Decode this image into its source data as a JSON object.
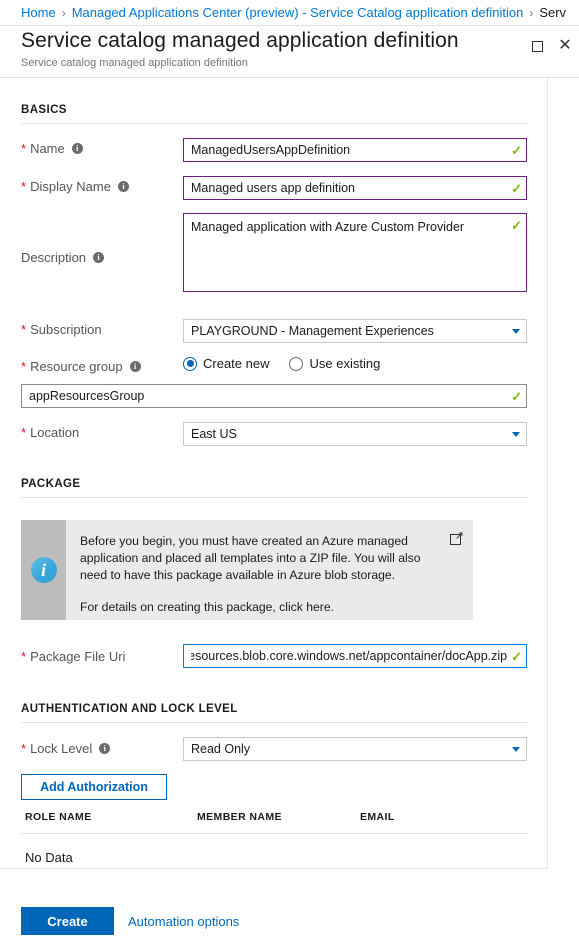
{
  "breadcrumb": {
    "items": [
      {
        "label": "Home"
      },
      {
        "label": "Managed Applications Center (preview) - Service Catalog application definition"
      },
      {
        "label": "Serv"
      }
    ],
    "separator": "›"
  },
  "blade": {
    "title": "Service catalog managed application definition",
    "subtitle": "Service catalog managed application definition",
    "maximize_icon": "maximize-icon",
    "close_icon": "close-icon"
  },
  "sections": {
    "basics": "BASICS",
    "package": "PACKAGE",
    "auth": "AUTHENTICATION AND LOCK LEVEL"
  },
  "fields": {
    "name": {
      "label": "Name",
      "required_marker": "*",
      "info": "i",
      "value": "ManagedUsersAppDefinition",
      "valid_icon": "✓"
    },
    "display_name": {
      "label": "Display Name",
      "required_marker": "*",
      "info": "i",
      "value": "Managed users app definition",
      "valid_icon": "✓"
    },
    "description": {
      "label": "Description",
      "info": "i",
      "value": "Managed application with Azure Custom Provider",
      "valid_icon": "✓"
    },
    "subscription": {
      "label": "Subscription",
      "required_marker": "*",
      "value": "PLAYGROUND - Management Experiences"
    },
    "resource_group": {
      "label": "Resource group",
      "required_marker": "*",
      "info": "i",
      "options": [
        {
          "label": "Create new",
          "selected": true
        },
        {
          "label": "Use existing",
          "selected": false
        }
      ],
      "value": "appResourcesGroup",
      "valid_icon": "✓"
    },
    "location": {
      "label": "Location",
      "required_marker": "*",
      "value": "East US"
    },
    "package_file_uri": {
      "label": "Package File Uri",
      "required_marker": "*",
      "value": "resources.blob.core.windows.net/appcontainer/docApp.zip",
      "valid_icon": "✓"
    },
    "lock_level": {
      "label": "Lock Level",
      "required_marker": "*",
      "info": "i",
      "value": "Read Only"
    }
  },
  "info_banner": {
    "icon": "info-icon",
    "paragraph1": "Before you begin, you must have created an Azure managed application and placed all templates into a ZIP file. You will also need to have this package available in Azure blob storage.",
    "paragraph2": "For details on creating this package, click here.",
    "external_link_icon": "external-link-icon"
  },
  "authorization": {
    "add_button": "Add Authorization",
    "columns": [
      "ROLE NAME",
      "MEMBER NAME",
      "EMAIL"
    ],
    "empty_text": "No Data"
  },
  "footer": {
    "create_label": "Create",
    "automation_label": "Automation options"
  },
  "colors": {
    "accent": "#0067b8",
    "link": "#0078d4",
    "valid_border": "#68217a",
    "focus_border": "#0078d4",
    "check_green": "#7fba00",
    "required_red": "#e81123",
    "banner_bg": "#eaeaea",
    "banner_stripe": "#bdbdbd"
  }
}
